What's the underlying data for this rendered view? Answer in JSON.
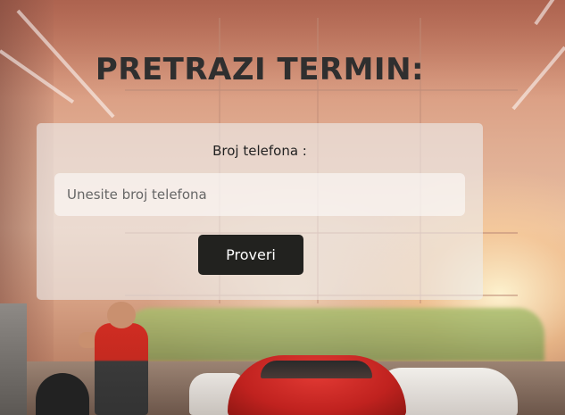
{
  "page": {
    "title": "PRETRAZI TERMIN:"
  },
  "form": {
    "phone_label": "Broj telefona :",
    "phone_placeholder": "Unesite broj telefona",
    "phone_value": "",
    "submit_label": "Proveri"
  },
  "colors": {
    "title_text": "#2f2f2f",
    "card_background": "rgba(238,238,238,0.62)",
    "button_background": "#22221f",
    "button_text": "#ffffff"
  }
}
